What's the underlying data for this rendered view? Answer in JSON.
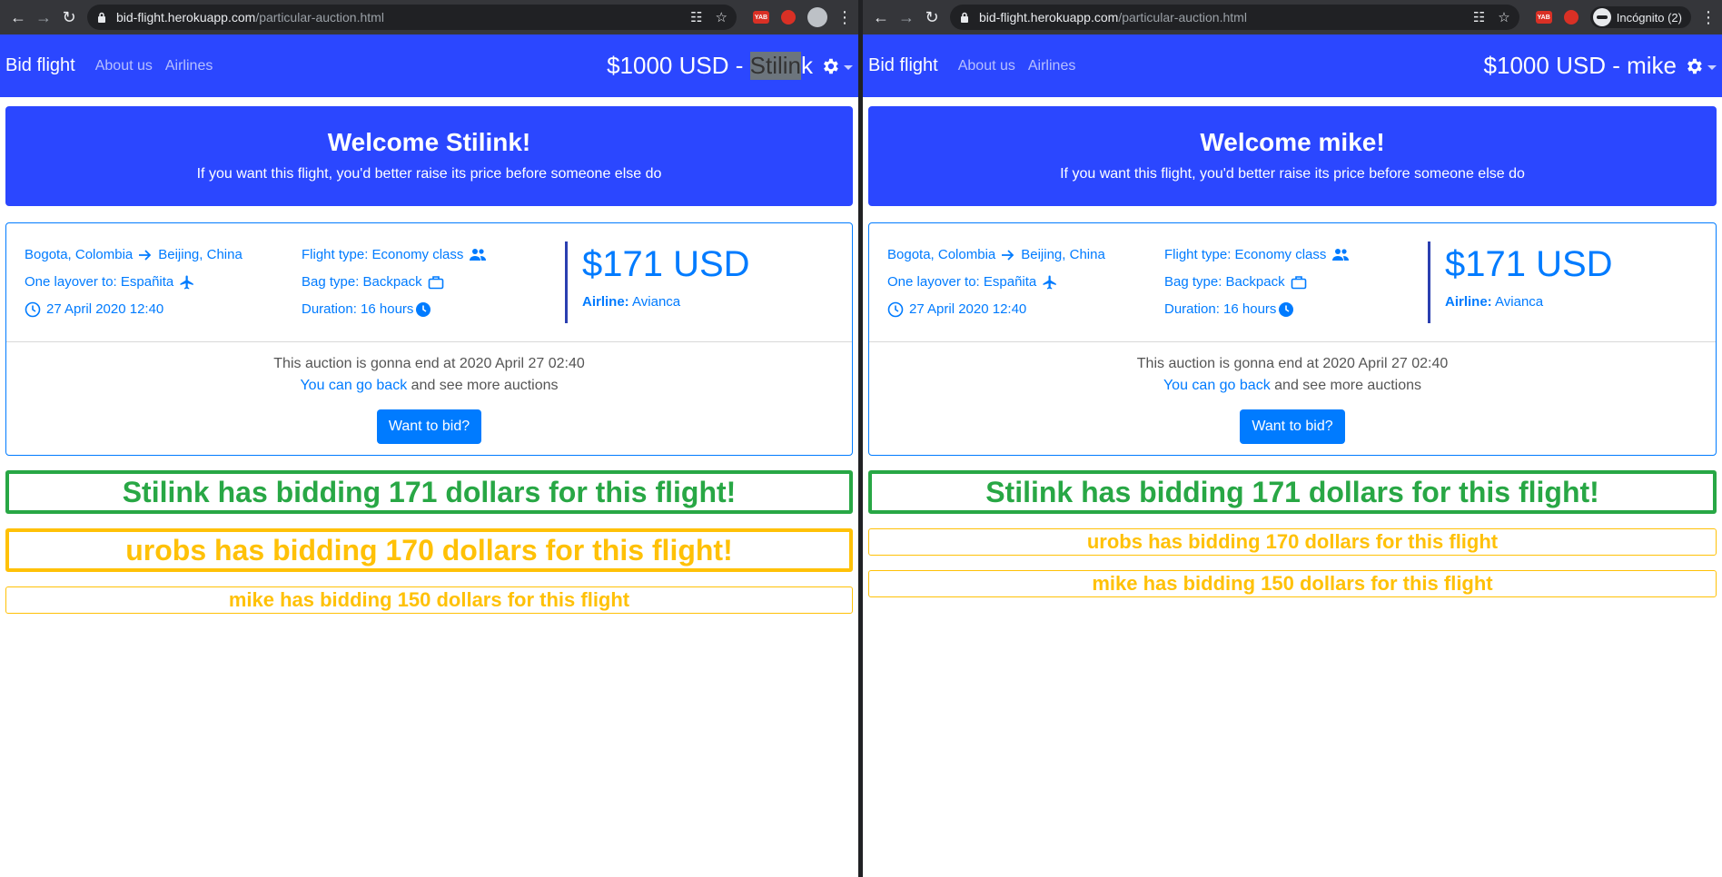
{
  "colors": {
    "nav_blue": "#2b47ff",
    "primary": "#007bff",
    "success": "#28a745",
    "warning": "#ffc107"
  },
  "windows": [
    {
      "url_host": "bid-flight.herokuapp.com",
      "url_path": "/particular-auction.html",
      "profile": "",
      "nav": {
        "brand": "Bid flight",
        "about": "About us",
        "airlines": "Airlines",
        "balance": "$1000 USD - ",
        "user_a": "Stil",
        "user_b": "in",
        "user_c": "k"
      },
      "welcome_title": "Welcome Stilink!",
      "welcome_sub": "If you want this flight, you'd better raise its price before someone else do",
      "flight": {
        "origin": "Bogota, Colombia",
        "destination": "Beijing, China",
        "layover": "One layover to: Españita",
        "date": "27 April 2020 12:40",
        "type": "Flight type: Economy class",
        "bag": "Bag type: Backpack",
        "duration": "Duration: 16 hours",
        "price": "$171 USD",
        "airline_label": "Airline:",
        "airline": "Avianca"
      },
      "auction_end": "This auction is gonna end at 2020 April 27 02:40",
      "go_back_link": "You can go back",
      "go_back_rest": " and see more auctions",
      "bid_button": "Want to bid?",
      "bids": [
        "Stilink has bidding 171 dollars for this flight!",
        "urobs has bidding 170 dollars for this flight!",
        "mike has bidding 150 dollars for this flight"
      ]
    },
    {
      "url_host": "bid-flight.herokuapp.com",
      "url_path": "/particular-auction.html",
      "profile": "Incógnito (2)",
      "nav": {
        "brand": "Bid flight",
        "about": "About us",
        "airlines": "Airlines",
        "balance": "$1000 USD - ",
        "user_a": "mike",
        "user_b": "",
        "user_c": ""
      },
      "welcome_title": "Welcome mike!",
      "welcome_sub": "If you want this flight, you'd better raise its price before someone else do",
      "flight": {
        "origin": "Bogota, Colombia",
        "destination": "Beijing, China",
        "layover": "One layover to: Españita",
        "date": "27 April 2020 12:40",
        "type": "Flight type: Economy class",
        "bag": "Bag type: Backpack",
        "duration": "Duration: 16 hours",
        "price": "$171 USD",
        "airline_label": "Airline:",
        "airline": "Avianca"
      },
      "auction_end": "This auction is gonna end at 2020 April 27 02:40",
      "go_back_link": "You can go back",
      "go_back_rest": " and see more auctions",
      "bid_button": "Want to bid?",
      "bids": [
        "Stilink has bidding 171 dollars for this flight!",
        "urobs has bidding 170 dollars for this flight",
        "mike has bidding 150 dollars for this flight"
      ]
    }
  ]
}
